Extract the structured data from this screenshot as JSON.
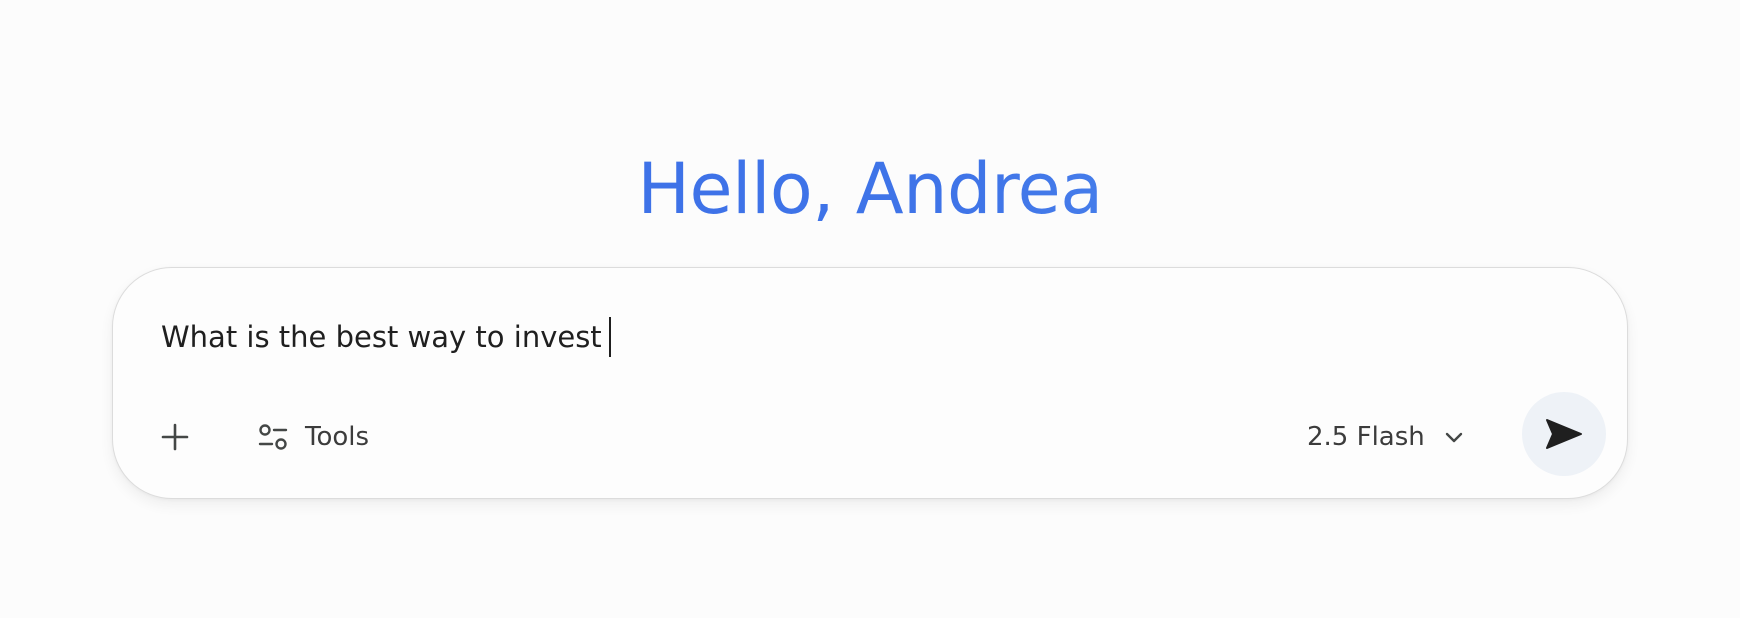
{
  "greeting": {
    "text": "Hello, Andrea",
    "gradient_colors": [
      "#3b6ee6",
      "#3f74e8",
      "#5fa0f2"
    ]
  },
  "composer": {
    "input_value": "What is the best way to invest",
    "add_icon": "plus-icon",
    "tools": {
      "icon": "sliders-icon",
      "label": "Tools"
    },
    "model": {
      "label": "2.5 Flash",
      "icon": "chevron-down-icon"
    },
    "send": {
      "icon": "send-icon",
      "background": "#eef2f7"
    }
  }
}
